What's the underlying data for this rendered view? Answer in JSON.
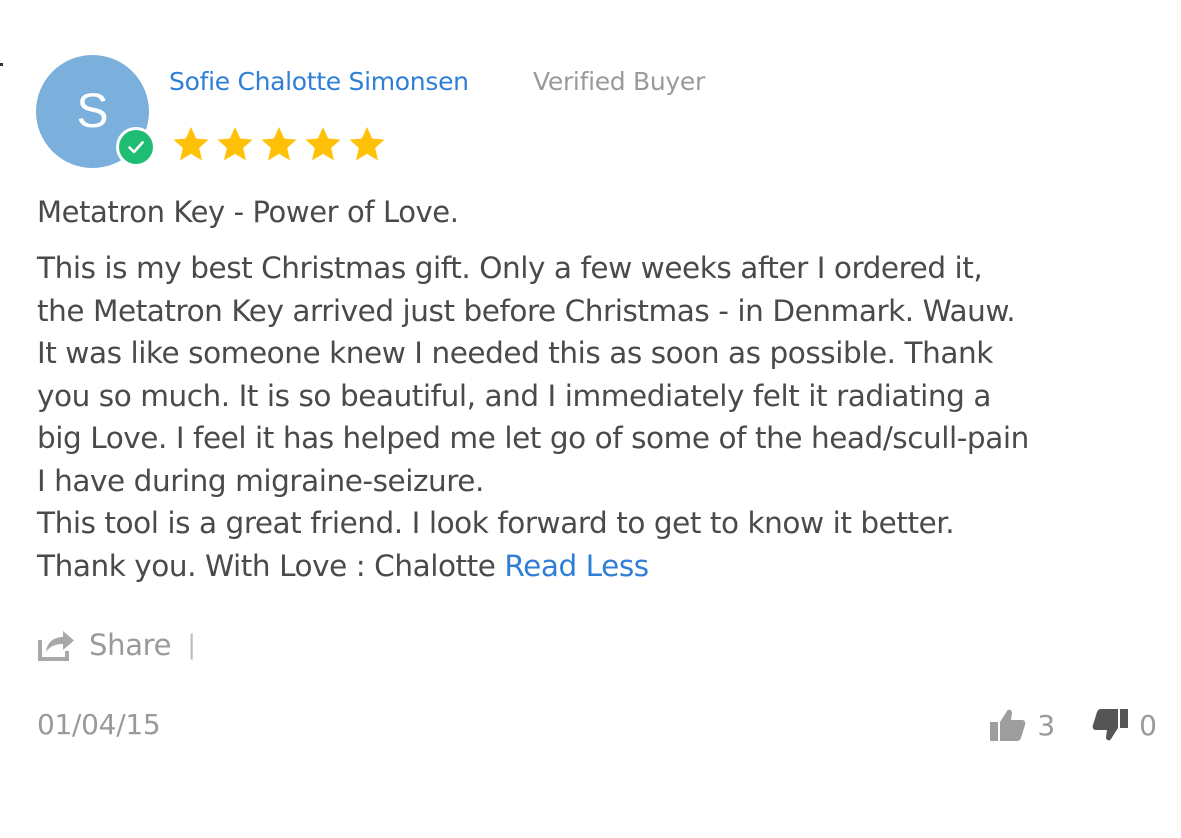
{
  "review": {
    "avatar_initial": "S",
    "reviewer_name": "Sofie Chalotte Simonsen",
    "verified_label": "Verified Buyer",
    "rating": 5,
    "rating_max": 5,
    "title": "Metatron Key - Power of Love.",
    "body_lines": [
      "This is my best Christmas gift. Only a few weeks after I ordered it,",
      "the Metatron Key arrived just before Christmas - in Denmark. Wauw.",
      "It was like someone knew I needed this as soon as possible. Thank",
      "you so much. It is so beautiful, and I immediately felt it radiating a",
      "big Love. I feel it has helped me let go of some of the head/scull-pain",
      "I have during migraine-seizure.",
      "This tool is a great friend. I look forward to get to know it better."
    ],
    "body_last_line": "Thank you. With Love : Chalotte",
    "read_less_label": "Read Less",
    "date": "01/04/15"
  },
  "actions": {
    "share_label": "Share",
    "separator": "|",
    "thumbs_up_count": "3",
    "thumbs_down_count": "0"
  },
  "icons": {
    "verified": "check-circle-icon",
    "star": "star-icon",
    "share": "share-icon",
    "thumbs_up": "thumbs-up-icon",
    "thumbs_down": "thumbs-down-icon"
  },
  "colors": {
    "avatar": "#7bafdc",
    "verified_badge": "#1fbd73",
    "link": "#2f7fd6",
    "star": "#ffc107",
    "muted_text": "#9a9a9a",
    "body_text": "#4a4a4a"
  }
}
